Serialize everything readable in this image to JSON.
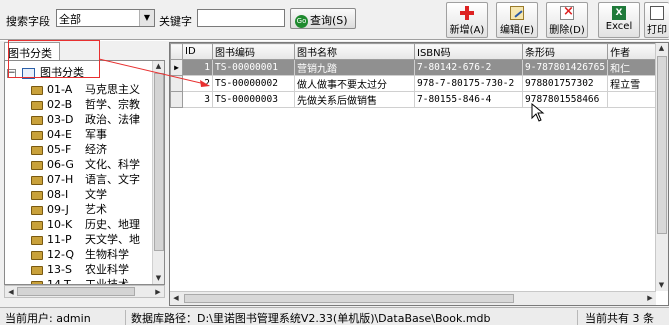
{
  "search": {
    "field_label": "搜索字段",
    "field_value": "全部",
    "keyword_label": "关键字",
    "keyword_value": "",
    "query_button": "查询(S)",
    "query_icon": "go-icon"
  },
  "toolbar": {
    "add": "新增(A)",
    "edit": "编辑(E)",
    "delete": "删除(D)",
    "excel": "Excel",
    "print": "打印"
  },
  "sidebar": {
    "tab": "图书分类",
    "root": "图书分类",
    "items": [
      {
        "code": "01-A",
        "name": "马克思主义"
      },
      {
        "code": "02-B",
        "name": "哲学、宗教"
      },
      {
        "code": "03-D",
        "name": "政治、法律"
      },
      {
        "code": "04-E",
        "name": "军事"
      },
      {
        "code": "05-F",
        "name": "经济"
      },
      {
        "code": "06-G",
        "name": "文化、科学"
      },
      {
        "code": "07-H",
        "name": "语言、文字"
      },
      {
        "code": "08-I",
        "name": "文学"
      },
      {
        "code": "09-J",
        "name": "艺术"
      },
      {
        "code": "10-K",
        "name": "历史、地理"
      },
      {
        "code": "11-P",
        "name": "天文学、地"
      },
      {
        "code": "12-Q",
        "name": "生物科学"
      },
      {
        "code": "13-S",
        "name": "农业科学"
      },
      {
        "code": "14-T",
        "name": "工业技术"
      }
    ]
  },
  "grid": {
    "columns": [
      "ID",
      "图书编码",
      "图书名称",
      "ISBN码",
      "条形码",
      "作者"
    ],
    "rows": [
      {
        "id": "1",
        "code": "TS-00000001",
        "name": "营销九踏",
        "isbn": "7-80142-676-2",
        "barcode": "9-787801426765",
        "author": "和仁"
      },
      {
        "id": "2",
        "code": "TS-00000002",
        "name": "做人做事不要太过分",
        "isbn": "978-7-80175-730-2",
        "barcode": "978801757302",
        "author": "程立雪"
      },
      {
        "id": "3",
        "code": "TS-00000003",
        "name": "先做关系后做销售",
        "isbn": "7-80155-846-4",
        "barcode": "9787801558466",
        "author": ""
      }
    ]
  },
  "status": {
    "user": "当前用户: admin",
    "db_path": "数据库路径：D:\\里诺图书管理系统V2.33(单机版)\\DataBase\\Book.mdb",
    "total": "当前共有 3 条"
  },
  "colors": {
    "annotation": "#e83030",
    "selected_row": "#909090"
  }
}
